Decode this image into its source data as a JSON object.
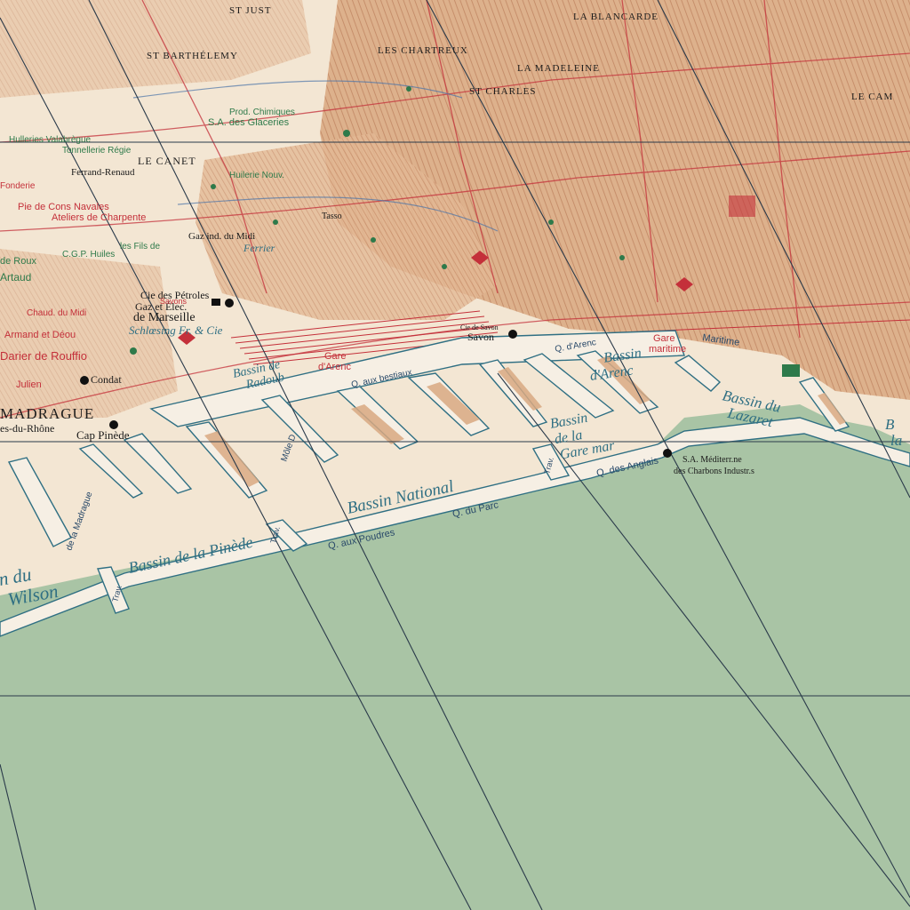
{
  "colors": {
    "sea": "#a9c4a5",
    "land": "#f3e6d3",
    "urban": "#d9a982",
    "urban_dark": "#c78e6b",
    "quay": "#f6efe4",
    "quay_stroke": "#2f6f83",
    "grid": "#2a3a4a",
    "rail": "#c4303a"
  },
  "districts": {
    "st_just": "ST JUST",
    "la_blancarde": "LA BLANCARDE",
    "st_barthelemy": "ST BARTHÉLEMY",
    "les_chartreux": "LES CHARTREUX",
    "la_madeleine": "LA MADELEINE",
    "st_charles": "ST CHARLES",
    "le_camas": "LE CAM",
    "le_canet": "LE CANET",
    "madrague": "MADRAGUE"
  },
  "water_labels": {
    "bassin_radoub": [
      "Bassin de",
      "Radoub"
    ],
    "bassin_arenc": [
      "Bassin",
      "d'Arenc"
    ],
    "bassin_lazaret": [
      "Bassin du",
      "Lazaret"
    ],
    "bassin_gare_maritime": [
      "Bassin",
      "de la",
      "Gare mar"
    ],
    "bassin_national": "Bassin National",
    "bassin_pinede": "Bassin de la Pinède",
    "bassin_wilson": [
      "n du",
      "Wilson"
    ],
    "bassin_edge": [
      "B",
      "la"
    ]
  },
  "quay_labels": {
    "q_aux_poudres": "Q. aux Poudres",
    "q_du_parc": "Q. du Parc",
    "q_des_anglais": "Q. des Anglais",
    "q_d_arenc": "Q. d'Arenc",
    "q_aux_bestiaux": "Q. aux bestiaux",
    "mole_d": "Môle D",
    "travers_1": "Trav.",
    "travers_2": "Trav.",
    "travers_3": "Trav.",
    "de_la_madrague": "de la Madrague",
    "gare_arenc": [
      "Gare",
      "d'Arenc"
    ],
    "gare_maritime": [
      "Gare",
      "maritime"
    ],
    "maritime_bd": "Maritime"
  },
  "industry_labels": {
    "petroles": "Cie des Pétroles",
    "gaz_elec": "Gaz et Élec.",
    "de_marseille": "de Marseille",
    "schloesing": "Schlœsing Fr. & Cie",
    "gaz_ind_midi": "Gaz ind. du Midi",
    "ferrand_renaud": "Ferrand-Renaud",
    "tasso": "Tasso",
    "ferrier": "Ferrier",
    "condat": "Condat",
    "cap_pinede": "Cap Pinède",
    "savon": "Savon",
    "cie_savon": "Cie de Savon",
    "sa_mediterranee": "S.A. Méditerr.ne",
    "des_charbons": "des Charbons Industr.s",
    "chantiers": "Ateliers de Charpente",
    "armand": "Armand et Déou",
    "darier": "Darier de Rouffio",
    "julien": "Julien",
    "artaud": "Artaud",
    "de_roux": "de Roux",
    "rhone": "es-du-Rhône",
    "cgp": "C.G.P. Huiles",
    "fils": "les Fils de",
    "tonnellerie": "Tonnellerie Régie",
    "huileries": "Hulleries Valabrègue",
    "fonderie": "Fonderie",
    "chaudronnerie": "Chaud. du Midi",
    "construction": "Pie de Cons Navales",
    "cie_savons": "Savons",
    "sa_glaceries": "S.A. des Glaceries",
    "huilerie_nouv": "Huilerie Nouv.",
    "prod_chimiques": "Prod. Chimiques"
  }
}
